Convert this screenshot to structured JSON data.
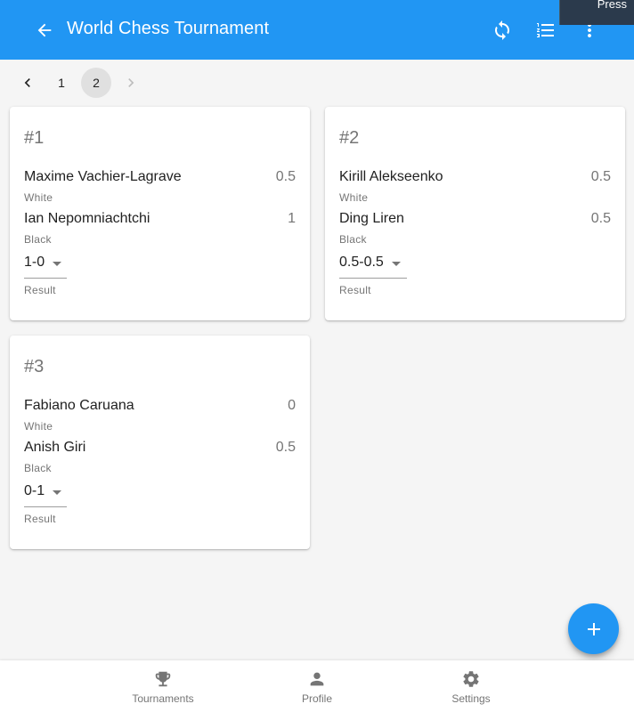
{
  "appbar": {
    "title": "World Chess Tournament",
    "back_icon": "arrow-left-icon",
    "actions": [
      "refresh-icon",
      "list-ordered-icon",
      "more-vertical-icon"
    ],
    "color": "#2196f3"
  },
  "tooltip": {
    "text": "Press"
  },
  "pagination": {
    "pages": [
      "1",
      "2"
    ],
    "active": "2"
  },
  "games": [
    {
      "number": "#1",
      "white": {
        "name": "Maxime Vachier-Lagrave",
        "score": "0.5",
        "label": "White"
      },
      "black": {
        "name": "Ian Nepomniachtchi",
        "score": "1",
        "label": "Black"
      },
      "result": {
        "value": "1-0",
        "label": "Result"
      }
    },
    {
      "number": "#2",
      "white": {
        "name": "Kirill Alekseenko",
        "score": "0.5",
        "label": "White"
      },
      "black": {
        "name": "Ding Liren",
        "score": "0.5",
        "label": "Black"
      },
      "result": {
        "value": "0.5-0.5",
        "label": "Result"
      }
    },
    {
      "number": "#3",
      "white": {
        "name": "Fabiano Caruana",
        "score": "0",
        "label": "White"
      },
      "black": {
        "name": "Anish Giri",
        "score": "0.5",
        "label": "Black"
      },
      "result": {
        "value": "0-1",
        "label": "Result"
      }
    }
  ],
  "fab": {
    "icon": "plus-icon"
  },
  "bottom_nav": [
    {
      "label": "Tournaments",
      "icon": "trophy-icon"
    },
    {
      "label": "Profile",
      "icon": "person-icon"
    },
    {
      "label": "Settings",
      "icon": "gear-icon"
    }
  ]
}
